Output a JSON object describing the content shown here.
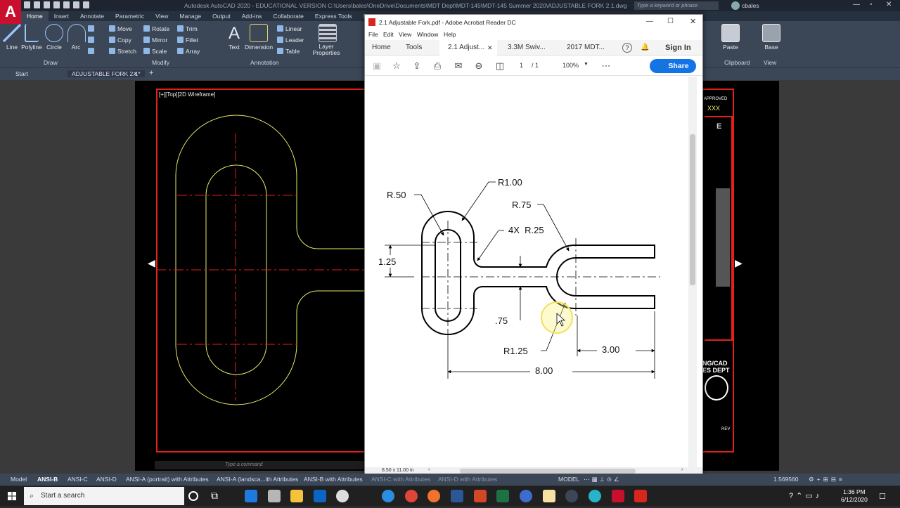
{
  "acad": {
    "title": "Autodesk AutoCAD 2020 - EDUCATIONAL VERSION     C:\\Users\\bales\\OneDrive\\Documents\\MDT Dept\\MDT-145\\MDT-145 Summer 2020\\ADJUSTABLE FORK 2.1.dwg",
    "logo": "A",
    "search_placeholder": "Type a keyword or phrase",
    "user": "cbales",
    "ribbon_tabs": [
      "Home",
      "Insert",
      "Annotate",
      "Parametric",
      "View",
      "Manage",
      "Output",
      "Add-ins",
      "Collaborate",
      "Express Tools",
      "Featured Apps"
    ],
    "draw_tools": [
      "Line",
      "Polyline",
      "Circle",
      "Arc"
    ],
    "modify_tools": [
      "Move",
      "Rotate",
      "Trim",
      "Copy",
      "Mirror",
      "Fillet",
      "Stretch",
      "Scale",
      "Array"
    ],
    "annotation_tools": [
      "Text",
      "Dimension",
      "Linear",
      "Leader",
      "Table"
    ],
    "layer_tool": "Layer Properties",
    "panel_draw": "Draw",
    "panel_modify": "Modify",
    "panel_annotation": "Annotation",
    "right_tools": [
      "Paste",
      "Base"
    ],
    "panel_clipboard": "Clipboard",
    "panel_view": "View",
    "file_tabs": [
      "Start",
      "ADJUSTABLE FORK 2.1*"
    ],
    "viewport_label": "[+][Top][2D Wireframe]",
    "titleblock": {
      "approved": "APPROVED",
      "xxx": "XXX",
      "dept1": "NG/CAD",
      "dept2": "ES DEPT",
      "rev": "REV",
      "letter": "E"
    },
    "command_placeholder": "Type a command",
    "layout_tabs": [
      "Model",
      "ANSI-B",
      "ANSI-C",
      "ANSI-D",
      "ANSI-A (portrait) with Attributes",
      "ANSI-A (landsca...ith Attributes",
      "ANSI-B with Attributes",
      "ANSI-C with Attributes",
      "ANSI-D with Attributes"
    ],
    "status_model": "MODEL",
    "status_scale": "1.569560"
  },
  "acrobat": {
    "title": "2.1 Adjustable Fork.pdf - Adobe Acrobat Reader DC",
    "menu": [
      "File",
      "Edit",
      "View",
      "Window",
      "Help"
    ],
    "tabs": [
      "Home",
      "Tools",
      "2.1 Adjust...",
      "3.3M Swiv...",
      "2017 MDT..."
    ],
    "sign_in": "Sign In",
    "page_current": "1",
    "page_total": "/ 1",
    "zoom": "100%",
    "share": "Share",
    "page_size": "8.50 x 11.00 in",
    "dims": {
      "r100": "R1.00",
      "r50": "R.50",
      "r75": "R.75",
      "r25": "4X  R.25",
      "d125": "1.25",
      "d75": ".75",
      "r125": "R1.25",
      "d300": "3.00",
      "d800": "8.00"
    }
  },
  "taskbar": {
    "search": "Start a search",
    "time": "1:36 PM",
    "date": "6/12/2020"
  },
  "colors": {
    "acad_red": "#e3201b",
    "acad_yellow": "#e8e86a",
    "acrobat_blue": "#1473e6"
  }
}
